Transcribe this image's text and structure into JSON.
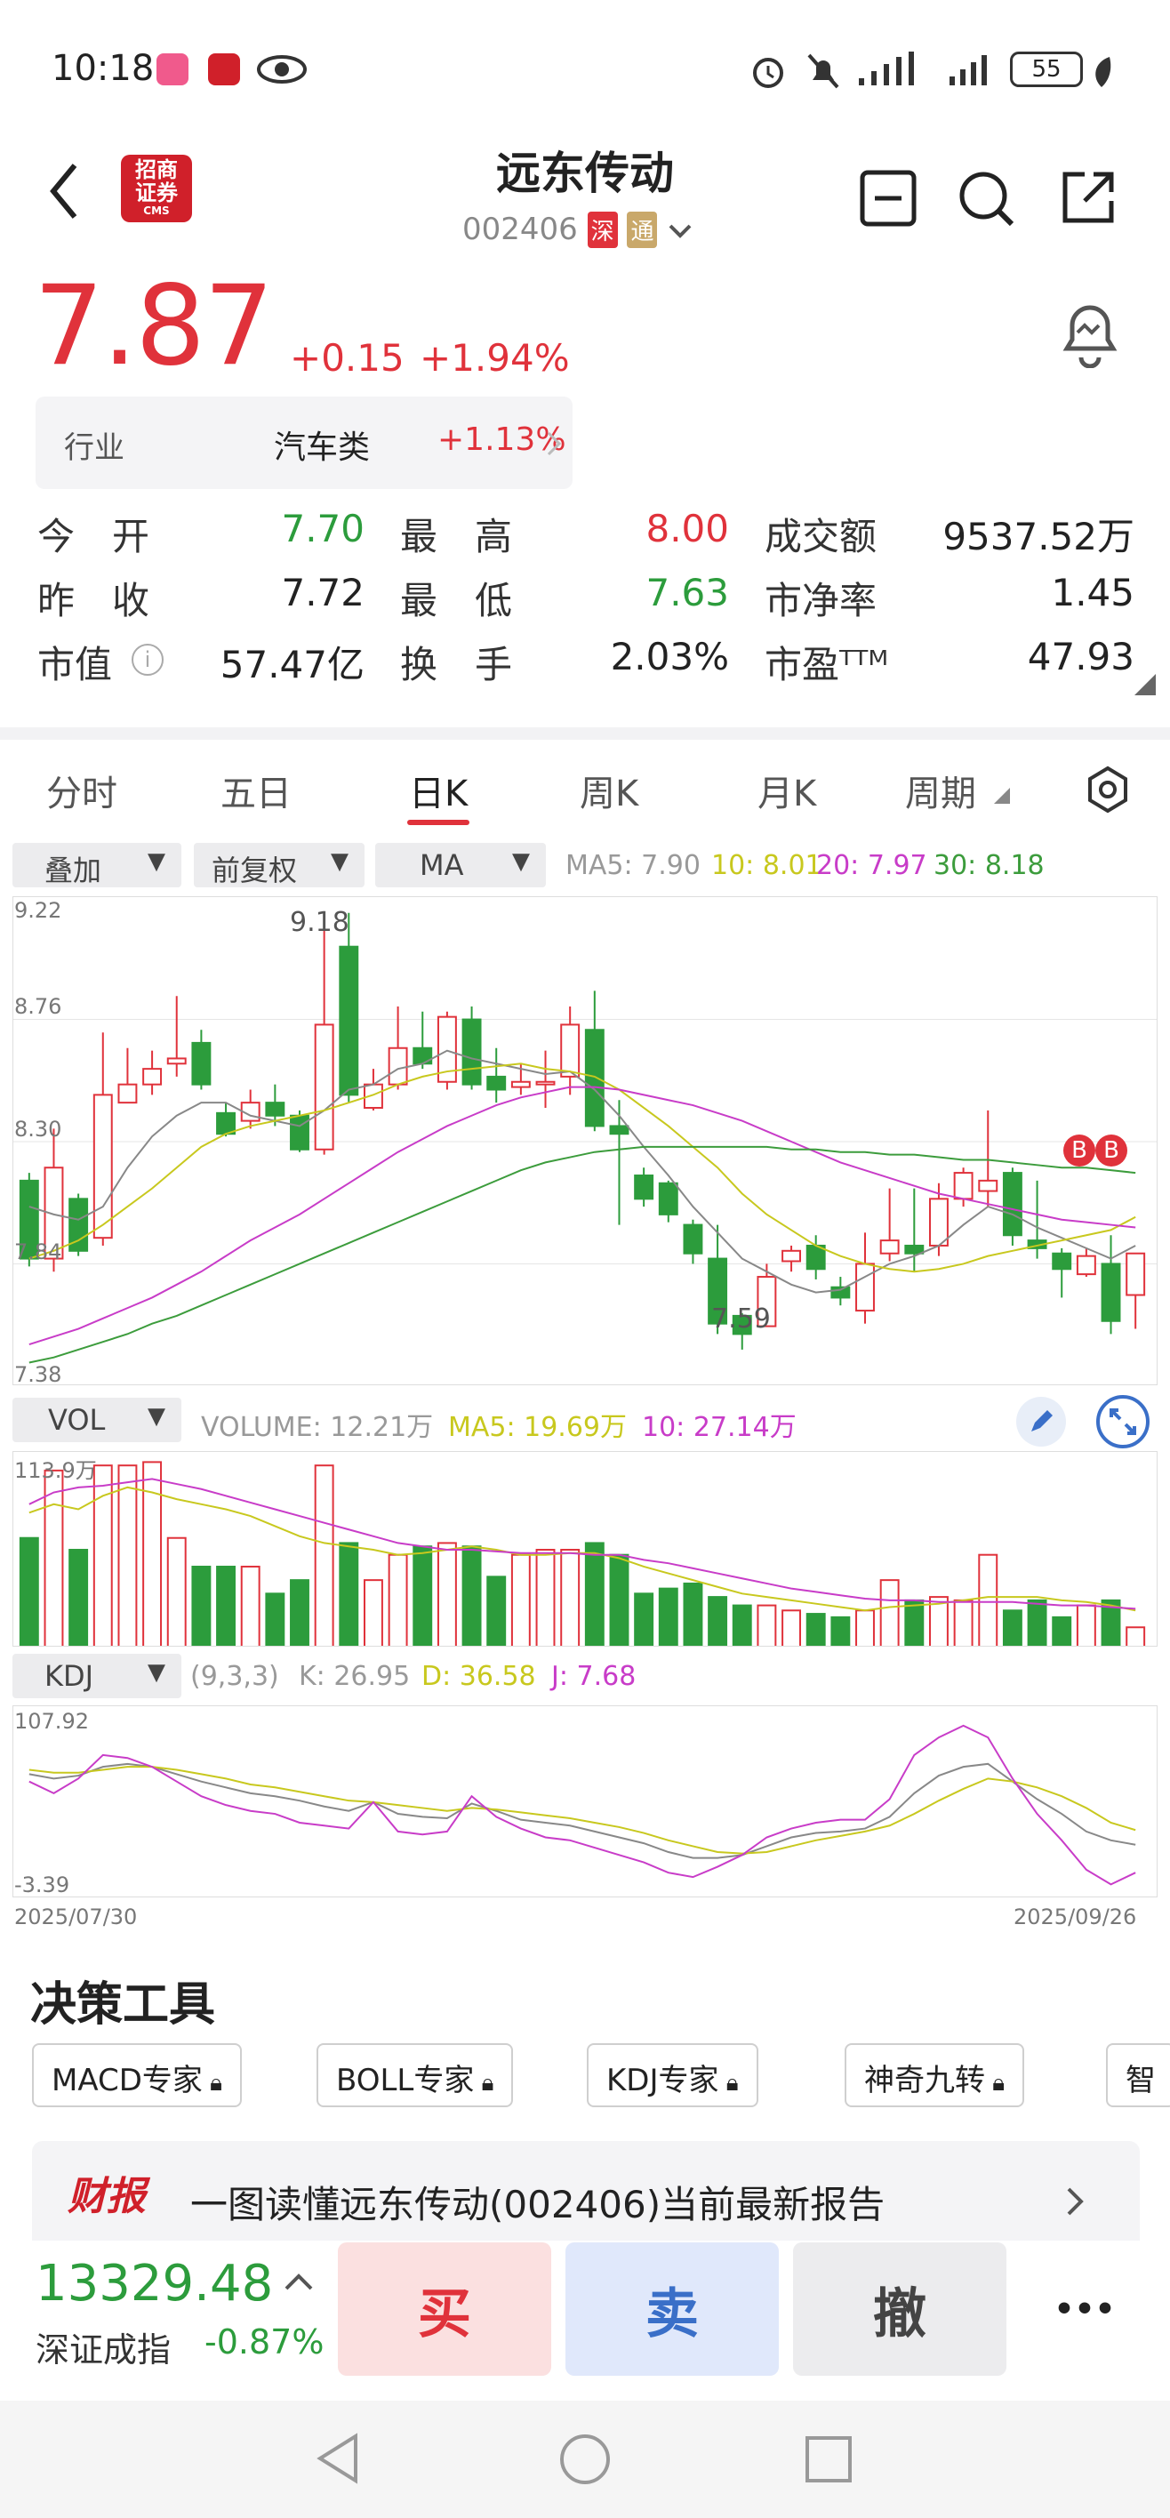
{
  "status": {
    "time": "10:18",
    "battery": "55"
  },
  "header": {
    "logo_lines": [
      "招商",
      "证券",
      "CMS"
    ],
    "title": "远东传动",
    "code": "002406",
    "badge_sz": "深",
    "badge_tong": "通"
  },
  "quote": {
    "price": "7.87",
    "change": "+0.15",
    "change_pct": "+1.94%",
    "industry_label": "行业",
    "industry_name": "汽车类",
    "industry_pct": "+1.13%",
    "rows": [
      [
        {
          "label": "今　开",
          "value": "7.70",
          "color": "green"
        },
        {
          "label": "最　高",
          "value": "8.00",
          "color": "red"
        },
        {
          "label": "成交额",
          "value": "9537.52万",
          "color": "black"
        }
      ],
      [
        {
          "label": "昨　收",
          "value": "7.72",
          "color": "black"
        },
        {
          "label": "最　低",
          "value": "7.63",
          "color": "green"
        },
        {
          "label": "市净率",
          "value": "1.45",
          "color": "black"
        }
      ],
      [
        {
          "label": "市值",
          "value": "57.47亿",
          "color": "black"
        },
        {
          "label": "换　手",
          "value": "2.03%",
          "color": "black"
        },
        {
          "label": "市盈ᵀᵀᴹ",
          "value": "47.93",
          "color": "black"
        }
      ]
    ]
  },
  "tabs": [
    "分时",
    "五日",
    "日K",
    "周K",
    "月K",
    "周期"
  ],
  "selectors": {
    "overlay": "叠加",
    "adjust": "前复权",
    "ma": "MA",
    "vol": "VOL",
    "kdj": "KDJ"
  },
  "ma_legend": {
    "ma5": "MA5: 7.90",
    "ma10": "10: 8.01",
    "ma20": "20: 7.97",
    "ma30": "30: 8.18"
  },
  "vol_legend": {
    "volume": "VOLUME: 12.21万",
    "ma5": "MA5: 19.69万",
    "ma10": "10: 27.14万"
  },
  "kdj_legend": {
    "params": "(9,3,3)",
    "k": "K: 26.95",
    "d": "D: 36.58",
    "j": "J: 7.68"
  },
  "colors": {
    "up": "#e0323b",
    "down": "#2c9c3c",
    "ma5": "#888888",
    "ma10": "#c8c81e",
    "ma20": "#c83cc8",
    "ma30": "#3c9c3c"
  },
  "chart_data": [
    {
      "type": "candlestick",
      "title": "日K",
      "ylim": [
        7.38,
        9.22
      ],
      "y_ticks": [
        "9.22",
        "8.76",
        "8.30",
        "7.84",
        "7.38"
      ],
      "annotations": {
        "max_label": "9.18",
        "min_label": "7.59",
        "signals": [
          "B",
          "B"
        ]
      },
      "candles": [
        [
          8.15,
          7.85,
          8.18,
          7.82
        ],
        [
          7.85,
          8.2,
          8.35,
          7.8
        ],
        [
          8.08,
          7.88,
          8.1,
          7.86
        ],
        [
          7.93,
          8.48,
          8.72,
          7.9
        ],
        [
          8.45,
          8.52,
          8.66,
          8.45
        ],
        [
          8.52,
          8.58,
          8.65,
          8.48
        ],
        [
          8.6,
          8.62,
          8.86,
          8.55
        ],
        [
          8.68,
          8.52,
          8.73,
          8.5
        ],
        [
          8.41,
          8.33,
          8.45,
          8.32
        ],
        [
          8.38,
          8.45,
          8.5,
          8.35
        ],
        [
          8.45,
          8.4,
          8.52,
          8.36
        ],
        [
          8.4,
          8.27,
          8.42,
          8.26
        ],
        [
          8.27,
          8.75,
          9.18,
          8.25
        ],
        [
          9.05,
          8.48,
          9.18,
          8.45
        ],
        [
          8.43,
          8.52,
          8.58,
          8.42
        ],
        [
          8.52,
          8.66,
          8.82,
          8.5
        ],
        [
          8.66,
          8.6,
          8.8,
          8.58
        ],
        [
          8.53,
          8.78,
          8.8,
          8.5
        ],
        [
          8.77,
          8.52,
          8.82,
          8.5
        ],
        [
          8.55,
          8.5,
          8.66,
          8.45
        ],
        [
          8.51,
          8.53,
          8.6,
          8.48
        ],
        [
          8.52,
          8.53,
          8.65,
          8.43
        ],
        [
          8.55,
          8.75,
          8.82,
          8.48
        ],
        [
          8.73,
          8.36,
          8.88,
          8.34
        ],
        [
          8.36,
          8.33,
          8.46,
          7.98
        ],
        [
          8.17,
          8.08,
          8.2,
          8.05
        ],
        [
          8.14,
          8.02,
          8.15,
          7.99
        ],
        [
          7.98,
          7.87,
          8.0,
          7.83
        ],
        [
          7.85,
          7.6,
          7.98,
          7.56
        ],
        [
          7.63,
          7.56,
          7.64,
          7.5
        ],
        [
          7.59,
          7.78,
          7.83,
          7.59
        ],
        [
          7.84,
          7.88,
          7.9,
          7.8
        ],
        [
          7.9,
          7.81,
          7.94,
          7.77
        ],
        [
          7.74,
          7.7,
          7.78,
          7.67
        ],
        [
          7.65,
          7.83,
          7.95,
          7.6
        ],
        [
          7.87,
          7.92,
          8.12,
          7.84
        ],
        [
          7.9,
          7.87,
          8.12,
          7.8
        ],
        [
          7.9,
          8.08,
          8.14,
          7.86
        ],
        [
          8.08,
          8.18,
          8.2,
          8.05
        ],
        [
          8.11,
          8.15,
          8.42,
          8.05
        ],
        [
          8.18,
          7.94,
          8.2,
          7.9
        ],
        [
          7.92,
          7.89,
          8.15,
          7.85
        ],
        [
          7.87,
          7.81,
          7.89,
          7.7
        ],
        [
          7.79,
          7.86,
          7.89,
          7.78
        ],
        [
          7.83,
          7.61,
          7.94,
          7.56
        ],
        [
          7.71,
          7.87,
          7.87,
          7.58
        ]
      ],
      "ma5": [
        8.05,
        8.02,
        8.0,
        8.05,
        8.2,
        8.32,
        8.4,
        8.45,
        8.45,
        8.4,
        8.38,
        8.36,
        8.42,
        8.5,
        8.52,
        8.58,
        8.6,
        8.65,
        8.62,
        8.6,
        8.58,
        8.56,
        8.57,
        8.5,
        8.4,
        8.28,
        8.17,
        8.05,
        7.95,
        7.85,
        7.8,
        7.75,
        7.72,
        7.73,
        7.78,
        7.83,
        7.86,
        7.9,
        7.98,
        8.05,
        8.02,
        7.97,
        7.93,
        7.89,
        7.85,
        7.9
      ],
      "ma10": [
        7.85,
        7.88,
        7.92,
        7.98,
        8.05,
        8.12,
        8.2,
        8.28,
        8.33,
        8.36,
        8.38,
        8.4,
        8.42,
        8.45,
        8.48,
        8.52,
        8.55,
        8.57,
        8.58,
        8.59,
        8.6,
        8.58,
        8.57,
        8.55,
        8.5,
        8.43,
        8.36,
        8.28,
        8.2,
        8.1,
        8.02,
        7.96,
        7.9,
        7.86,
        7.83,
        7.81,
        7.8,
        7.81,
        7.83,
        7.86,
        7.88,
        7.9,
        7.92,
        7.94,
        7.96,
        8.01
      ],
      "ma20": [
        7.52,
        7.55,
        7.58,
        7.62,
        7.66,
        7.7,
        7.75,
        7.8,
        7.86,
        7.92,
        7.97,
        8.02,
        8.08,
        8.14,
        8.2,
        8.26,
        8.31,
        8.36,
        8.4,
        8.44,
        8.47,
        8.49,
        8.51,
        8.51,
        8.5,
        8.48,
        8.46,
        8.44,
        8.41,
        8.38,
        8.34,
        8.3,
        8.26,
        8.22,
        8.19,
        8.16,
        8.13,
        8.1,
        8.08,
        8.06,
        8.04,
        8.02,
        8.0,
        7.99,
        7.98,
        7.97
      ],
      "ma30": [
        7.45,
        7.47,
        7.5,
        7.53,
        7.56,
        7.6,
        7.63,
        7.67,
        7.71,
        7.75,
        7.79,
        7.83,
        7.87,
        7.91,
        7.95,
        7.99,
        8.03,
        8.07,
        8.11,
        8.15,
        8.19,
        8.22,
        8.24,
        8.26,
        8.27,
        8.28,
        8.28,
        8.28,
        8.28,
        8.28,
        8.28,
        8.27,
        8.27,
        8.26,
        8.26,
        8.25,
        8.25,
        8.24,
        8.23,
        8.23,
        8.22,
        8.21,
        8.2,
        8.2,
        8.19,
        8.18
      ]
    },
    {
      "type": "bar",
      "title": "VOL",
      "ylim": [
        0,
        113.9
      ],
      "y_ticks": [
        "113.9万"
      ],
      "values": [
        65,
        105,
        58,
        108,
        108,
        110,
        65,
        48,
        48,
        48,
        32,
        40,
        108,
        62,
        40,
        55,
        60,
        62,
        60,
        42,
        55,
        58,
        58,
        62,
        55,
        32,
        35,
        38,
        30,
        25,
        25,
        22,
        20,
        18,
        22,
        40,
        28,
        30,
        28,
        55,
        22,
        28,
        18,
        25,
        28,
        12
      ],
      "ma5": [
        80,
        85,
        82,
        90,
        95,
        92,
        88,
        85,
        82,
        78,
        72,
        66,
        62,
        60,
        58,
        55,
        56,
        58,
        60,
        58,
        55,
        55,
        56,
        56,
        53,
        48,
        44,
        40,
        36,
        32,
        30,
        28,
        26,
        24,
        22,
        24,
        25,
        26,
        28,
        30,
        30,
        30,
        28,
        27,
        25,
        22
      ],
      "ma10": [
        85,
        92,
        95,
        96,
        98,
        100,
        97,
        94,
        90,
        86,
        82,
        78,
        74,
        70,
        66,
        62,
        60,
        58,
        58,
        57,
        56,
        56,
        56,
        55,
        55,
        52,
        50,
        47,
        44,
        41,
        38,
        35,
        33,
        31,
        29,
        28,
        28,
        27,
        27,
        27,
        27,
        26,
        25,
        25,
        24,
        23
      ]
    },
    {
      "type": "line",
      "title": "KDJ",
      "ylim": [
        -3.39,
        107.92
      ],
      "y_ticks": [
        "107.92",
        "-3.39"
      ],
      "x_labels": [
        "2025/07/30",
        "2025/09/26"
      ],
      "series": [
        {
          "name": "K",
          "values": [
            75,
            72,
            74,
            80,
            82,
            80,
            75,
            70,
            66,
            62,
            60,
            57,
            53,
            50,
            56,
            48,
            46,
            45,
            55,
            50,
            44,
            42,
            40,
            36,
            32,
            28,
            22,
            18,
            18,
            20,
            26,
            32,
            35,
            36,
            38,
            46,
            62,
            74,
            80,
            82,
            70,
            58,
            48,
            36,
            30,
            27
          ]
        },
        {
          "name": "D",
          "values": [
            78,
            76,
            76,
            78,
            80,
            80,
            78,
            75,
            72,
            68,
            66,
            63,
            60,
            57,
            56,
            54,
            52,
            50,
            52,
            51,
            49,
            47,
            45,
            42,
            39,
            35,
            30,
            26,
            22,
            21,
            22,
            26,
            30,
            33,
            36,
            40,
            48,
            57,
            65,
            72,
            70,
            66,
            60,
            52,
            42,
            37
          ]
        },
        {
          "name": "J",
          "values": [
            70,
            62,
            72,
            88,
            86,
            80,
            70,
            60,
            54,
            50,
            48,
            42,
            40,
            38,
            56,
            36,
            34,
            36,
            60,
            46,
            38,
            32,
            30,
            25,
            20,
            15,
            8,
            5,
            12,
            20,
            32,
            38,
            42,
            44,
            44,
            58,
            88,
            100,
            108,
            100,
            72,
            48,
            30,
            10,
            0,
            8
          ]
        }
      ]
    }
  ],
  "tools": {
    "title": "决策工具",
    "items": [
      "MACD专家",
      "BOLL专家",
      "KDJ专家",
      "神奇九转",
      "智"
    ]
  },
  "report": {
    "badge": "财报",
    "text": "一图读懂远东传动(002406)当前最新报告"
  },
  "index": {
    "value": "13329.48",
    "name": "深证成指",
    "pct": "-0.87%"
  },
  "actions": {
    "buy": "买",
    "sell": "卖",
    "cancel": "撤",
    "more": "•••"
  }
}
